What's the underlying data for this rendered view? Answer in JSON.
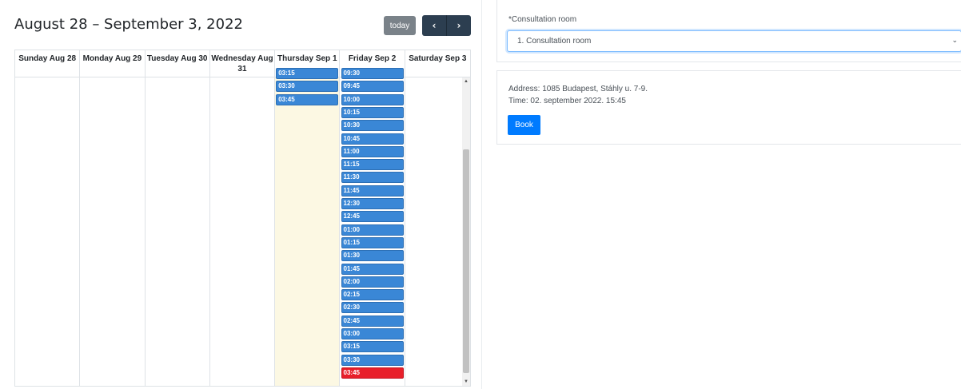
{
  "calendar": {
    "title": "August 28 – September 3, 2022",
    "today_label": "today",
    "prev_icon": "chevron-left-icon",
    "next_icon": "chevron-right-icon",
    "days": [
      "Sunday Aug 28",
      "Monday Aug 29",
      "Tuesday Aug 30",
      "Wednesday Aug 31",
      "Thursday Sep 1",
      "Friday Sep 2",
      "Saturday Sep 3"
    ],
    "thursday_slots": [
      "03:15",
      "03:30",
      "03:45"
    ],
    "friday_slots": [
      "09:30",
      "09:45",
      "10:00",
      "10:15",
      "10:30",
      "10:45",
      "11:00",
      "11:15",
      "11:30",
      "11:45",
      "12:30",
      "12:45",
      "01:00",
      "01:15",
      "01:30",
      "01:45",
      "02:00",
      "02:15",
      "02:30",
      "02:45",
      "03:00",
      "03:15",
      "03:30",
      "03:45"
    ],
    "selected_slot": "03:45",
    "slot_color": "#3a87d6",
    "selected_color": "#e81f2a",
    "today_bg": "#fcf8e3"
  },
  "booking": {
    "room_label": "*Consultation room",
    "room_value": "1. Consultation room",
    "address": "Address: 1085 Budapest, Stáhly u. 7-9.",
    "time": "Time: 02. september 2022. 15:45",
    "book_label": "Book",
    "book_color": "#007bff"
  }
}
